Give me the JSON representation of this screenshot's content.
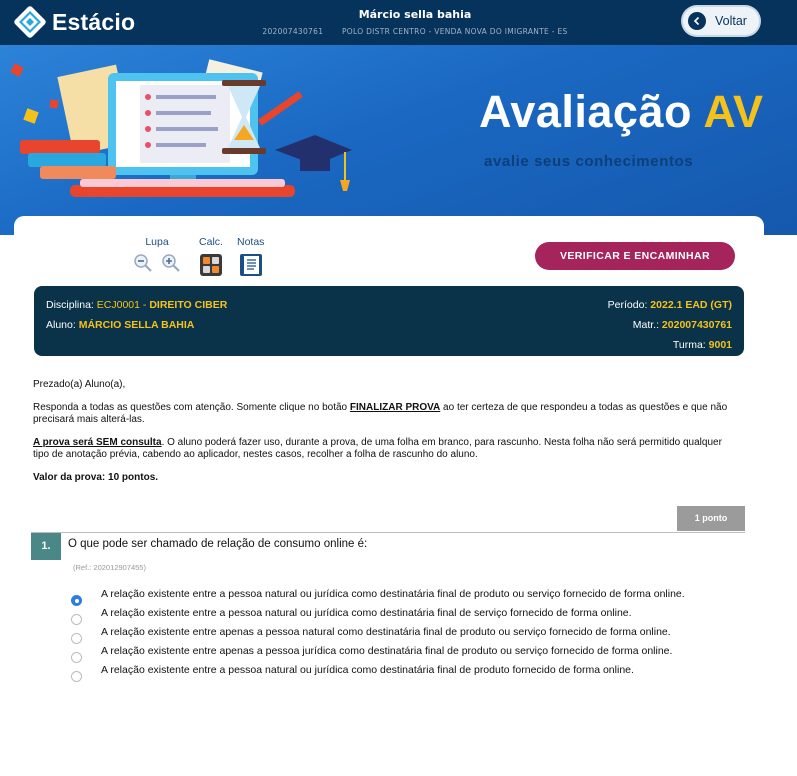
{
  "header": {
    "brand": "Estácio",
    "user_name": "Márcio sella bahia",
    "user_id": "202007430761",
    "polo": "POLO DISTR CENTRO - VENDA NOVA DO IMIGRANTE - ES",
    "back_label": "Voltar"
  },
  "banner": {
    "title_main": "Avaliação",
    "title_accent": "AV",
    "subtitle": "avalie seus conhecimentos"
  },
  "toolbar": {
    "lupa_label": "Lupa",
    "calc_label": "Calc.",
    "notas_label": "Notas",
    "verify_label": "VERIFICAR E ENCAMINHAR"
  },
  "info": {
    "disciplina_label": "Disciplina:",
    "disciplina_code": "ECJ0001",
    "disciplina_name": "DIREITO CIBER",
    "aluno_label": "Aluno:",
    "aluno_name": "MÁRCIO SELLA BAHIA",
    "periodo_label": "Período:",
    "periodo_value": "2022.1 EAD (GT)",
    "matr_label": "Matr.:",
    "matr_value": "202007430761",
    "turma_label": "Turma:",
    "turma_value": "9001"
  },
  "intro": {
    "greeting": "Prezado(a) Aluno(a),",
    "p1_a": "Responda a todas as questões com atenção. Somente clique no botão ",
    "p1_link": "FINALIZAR PROVA",
    "p1_b": " ao ter certeza de que respondeu a todas as questões e que não precisará mais alterá-las.",
    "p2_link": "A prova será SEM consulta",
    "p2_b": ". O aluno poderá fazer uso, durante a prova, de uma folha em branco, para rascunho. Nesta folha não será permitido qualquer tipo de anotação prévia, cabendo ao aplicador, nestes casos, recolher a folha de rascunho do aluno.",
    "valor": "Valor da prova: 10 pontos."
  },
  "question": {
    "points": "1 ponto",
    "number": "1.",
    "text": "O que pode ser chamado de relação de consumo online é:",
    "ref": "(Ref.: 202012907455)",
    "options": [
      {
        "text": "A relação existente entre a pessoa natural ou jurídica como destinatária final de produto ou serviço fornecido de forma online.",
        "selected": true
      },
      {
        "text": "A relação existente entre a pessoa natural ou jurídica como destinatária final de serviço fornecido de forma online.",
        "selected": false
      },
      {
        "text": "A relação existente entre apenas a pessoa natural como destinatária final de produto ou serviço fornecido de forma online.",
        "selected": false
      },
      {
        "text": "A relação existente entre apenas a pessoa jurídica como destinatária final de produto ou serviço fornecido de forma online.",
        "selected": false
      },
      {
        "text": "A relação existente entre a pessoa natural ou jurídica como destinatária final de produto  fornecido de forma online.",
        "selected": false
      }
    ]
  },
  "colors": {
    "topbar": "#06335c",
    "banner": "#1a68c2",
    "accent_yellow": "#f5c21b",
    "verify_button": "#a6245c",
    "infobox": "#0a3248",
    "question_number": "#4a8887",
    "radio_selected": "#2f7ce0"
  },
  "icons": [
    "estacio-logo-icon",
    "chevron-left-icon",
    "zoom-out-icon",
    "zoom-in-icon",
    "calculator-icon",
    "notes-icon"
  ]
}
